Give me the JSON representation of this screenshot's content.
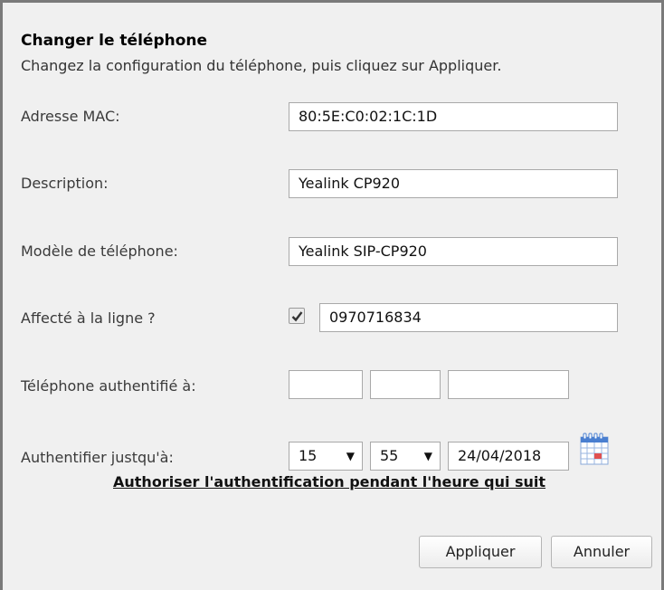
{
  "dialog": {
    "title": "Changer le téléphone",
    "subtitle": "Changez la configuration du téléphone, puis cliquez sur Appliquer."
  },
  "form": {
    "mac": {
      "label": "Adresse MAC:",
      "value": "80:5E:C0:02:1C:1D"
    },
    "description": {
      "label": "Description:",
      "value": "Yealink CP920"
    },
    "model": {
      "label": "Modèle de téléphone:",
      "value": "Yealink SIP-CP920"
    },
    "line": {
      "label": "Affecté à la ligne ?",
      "checked": true,
      "value": "0970716834"
    },
    "authenticated": {
      "label": "Téléphone authentifié à:",
      "values": [
        "",
        "",
        ""
      ]
    },
    "auth_until": {
      "label": "Authentifier justqu'à:",
      "hour": "15",
      "minute": "55",
      "date": "24/04/2018",
      "calendar_icon": "calendar-icon"
    },
    "auth_link": "Authoriser l'authentification pendant l'heure qui suit"
  },
  "buttons": {
    "apply": "Appliquer",
    "cancel": "Annuler"
  },
  "colors": {
    "background": "#f0f0f0",
    "border": "#7a7a7a",
    "calendar_blue": "#4a7fd0",
    "calendar_red": "#e05050"
  }
}
